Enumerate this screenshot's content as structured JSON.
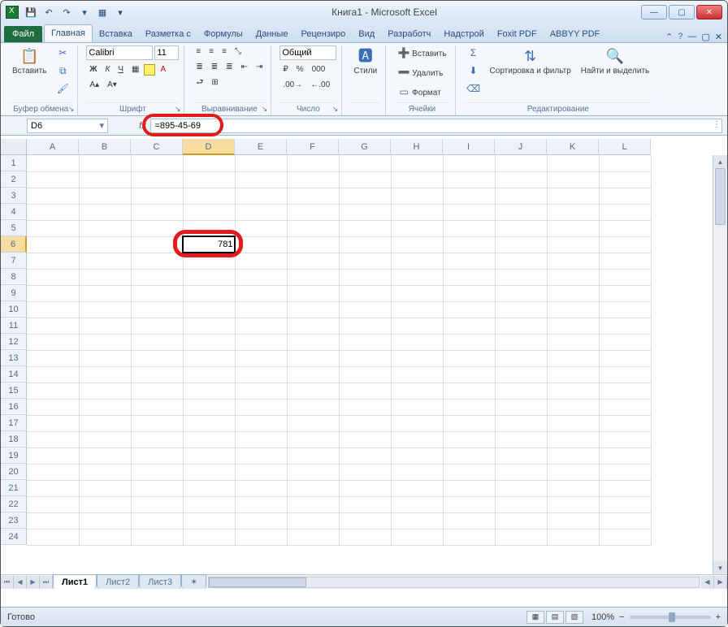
{
  "window": {
    "title": "Книга1 - Microsoft Excel"
  },
  "qat": {
    "save": "save",
    "undo": "undo",
    "redo": "redo"
  },
  "tabs": {
    "file": "Файл",
    "items": [
      "Главная",
      "Вставка",
      "Разметка с",
      "Формулы",
      "Данные",
      "Рецензиро",
      "Вид",
      "Разработч",
      "Надстрой",
      "Foxit PDF",
      "ABBYY PDF"
    ],
    "activeIndex": 0
  },
  "ribbon": {
    "clipboard": {
      "paste": "Вставить",
      "label": "Буфер обмена"
    },
    "font": {
      "name": "Calibri",
      "size": "11",
      "label": "Шрифт"
    },
    "alignment": {
      "label": "Выравнивание"
    },
    "number": {
      "format": "Общий",
      "label": "Число"
    },
    "styles": {
      "btn": "Стили",
      "label": ""
    },
    "cells": {
      "insert": "Вставить",
      "delete": "Удалить",
      "format": "Формат",
      "label": "Ячейки"
    },
    "editing": {
      "sort": "Сортировка и фильтр",
      "find": "Найти и выделить",
      "label": "Редактирование"
    }
  },
  "namebox": "D6",
  "formula": "=895-45-69",
  "grid": {
    "columns": [
      "A",
      "B",
      "C",
      "D",
      "E",
      "F",
      "G",
      "H",
      "I",
      "J",
      "K",
      "L"
    ],
    "rows": 24,
    "activeCol": "D",
    "activeRow": 6,
    "activeValue": "781"
  },
  "sheets": {
    "tabs": [
      "Лист1",
      "Лист2",
      "Лист3"
    ],
    "activeIndex": 0
  },
  "status": {
    "ready": "Готово",
    "zoom": "100%"
  }
}
